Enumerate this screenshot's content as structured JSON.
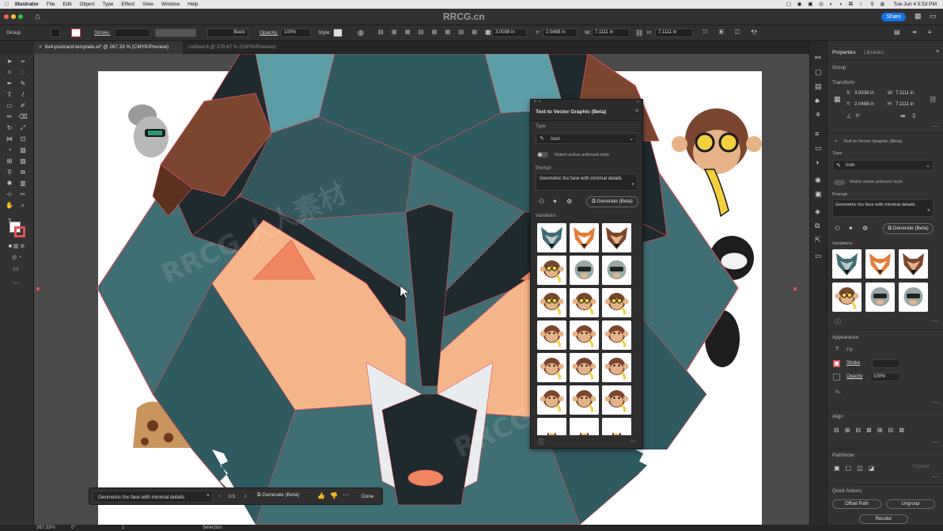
{
  "menubar": {
    "app_name": "Illustrator",
    "items": [
      "File",
      "Edit",
      "Object",
      "Type",
      "Effect",
      "View",
      "Window",
      "Help"
    ],
    "clock": "Tue Jun 4  5:53 PM"
  },
  "appbar": {
    "title_watermark": "RRCG.cn",
    "share_label": "Share"
  },
  "control_bar": {
    "selection_type": "Group",
    "stroke_label": "Stroke:",
    "stroke_style": "Basic",
    "opacity_label": "Opacity:",
    "opacity_value": "100%",
    "style_label": "Style:",
    "x_label": "X:",
    "x_value": "3.0038 in",
    "y_label": "Y:",
    "y_value": "2.0488 in",
    "w_label": "W:",
    "w_value": "7.1111 in",
    "h_label": "H:",
    "h_value": "7.1111 in"
  },
  "tabs": [
    {
      "label": "6x4-postcard-template.ai* @ 267.33 % (CMYK/Preview)",
      "active": true
    },
    {
      "label": "Untitled-6 @ 278.67 % (CMYK/Preview)",
      "active": false
    }
  ],
  "t2v_panel": {
    "title": "Text to Vector Graphic (Beta)",
    "type_label": "Type",
    "type_value": "Icon",
    "match_style_label": "Match active artboard style",
    "prompt_label": "Prompt",
    "prompt_value": "Geometric fox face with minimal details",
    "generate_label": "Generate (Beta)",
    "variations_label": "Variations"
  },
  "context_bar": {
    "prompt_value": "Geometric fox face with minimal details",
    "page_indicator": "1/3",
    "generate_label": "Generate (Beta)",
    "done_label": "Done"
  },
  "properties": {
    "tab_properties": "Properties",
    "tab_libraries": "Libraries",
    "selection_type": "Group",
    "transform_label": "Transform",
    "x_label": "X:",
    "x_value": "3.0038 in",
    "y_label": "Y:",
    "y_value": "2.0488 in",
    "w_label": "W:",
    "w_value": "7.1111 in",
    "h_label": "H:",
    "h_value": "7.1111 in",
    "rotate_value": "0°",
    "t2v_section": "Text to Vector Graphic (Beta)",
    "type_label": "Type",
    "type_value": "Icon",
    "match_style_label": "Match active artboard style",
    "prompt_label": "Prompt",
    "prompt_value": "Geometric fox face with minimal details",
    "generate_label": "Generate (Beta)",
    "variations_label": "Variations",
    "appearance_label": "Appearance",
    "fill_label": "Fill",
    "stroke_label": "Stroke",
    "opacity_label": "Opacity",
    "opacity_value": "100%",
    "fx_label": "fx.",
    "align_label": "Align",
    "pathfinder_label": "Pathfinder",
    "expand_label": "Expand",
    "quick_actions_label": "Quick Actions",
    "offset_path_label": "Offset Path",
    "ungroup_label": "Ungroup",
    "recolor_label": "Recolor"
  },
  "status": {
    "zoom": "267.33%",
    "rotation": "0°",
    "page": "1",
    "tool": "Selection"
  },
  "colors": {
    "accent": "#1473e6",
    "fox_teal": "#3f6e74",
    "fox_dark": "#1e2a2e",
    "fox_peach": "#f5b58a",
    "fox_orange": "#f08660",
    "fox_brown": "#7a4630",
    "selection_red": "#e0505a"
  }
}
